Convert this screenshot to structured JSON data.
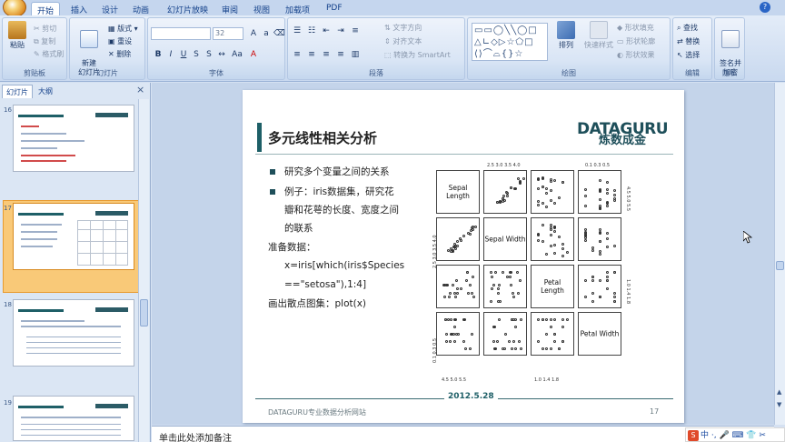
{
  "tabs": [
    "开始",
    "插入",
    "设计",
    "动画",
    "幻灯片放映",
    "审阅",
    "视图",
    "加载项",
    "PDF"
  ],
  "ribbon": {
    "clipboard": {
      "paste": "粘贴",
      "cut": "剪切",
      "copy": "复制",
      "format_painter": "格式刷",
      "label": "剪贴板"
    },
    "slides": {
      "new_slide": "新建\n幻灯片",
      "layout": "版式",
      "reset": "重设",
      "delete": "删除",
      "label": "幻灯片"
    },
    "font": {
      "font_size": "32",
      "label": "字体"
    },
    "paragraph": {
      "text_direction": "文字方向",
      "align_text": "对齐文本",
      "smartart": "转换为 SmartArt",
      "label": "段落"
    },
    "drawing": {
      "arrange": "排列",
      "quick_styles": "快速样式",
      "shape_fill": "形状填充",
      "shape_outline": "形状轮廓",
      "shape_effects": "形状效果",
      "label": "绘图"
    },
    "editing": {
      "find": "查找",
      "replace": "替换",
      "select": "选择",
      "label": "编辑"
    },
    "privacy": {
      "sign": "签名并\n加密",
      "label": "隐私"
    }
  },
  "left_pane": {
    "tabs": [
      "幻灯片",
      "大纲"
    ],
    "close": "×",
    "slide_numbers": [
      "16",
      "17",
      "18",
      "19"
    ],
    "selected_index": 1
  },
  "slide": {
    "title": "多元线性相关分析",
    "logo": "DATAGURU",
    "logo_sub": "炼数成金",
    "bullets": [
      "研究多个变量之间的关系",
      "例子：iris数据集，研究花",
      "瓣和花萼的长度、宽度之间",
      "的联系"
    ],
    "prep_label": "准备数据：",
    "code_lines": [
      "x=iris[which(iris$Species",
      "==\"setosa\"),1:4]"
    ],
    "plot_line": "画出散点图集：plot(x)",
    "footer_date": "2012.5.28",
    "footer_left": "DATAGURU专业数据分析网站",
    "page_number": "17"
  },
  "pairs_plot": {
    "diagonal_labels": [
      "Sepal Length",
      "Sepal Width",
      "Petal Length",
      "Petal Width"
    ],
    "top_ticks_1": "2.5 3.0 3.5 4.0",
    "top_ticks_2": "0.1  0.3  0.5",
    "bottom_ticks_1": "4.5  5.0  5.5",
    "bottom_ticks_2": "1.0  1.4  1.8",
    "right_ticks_1": "4.5  5.0  5.5",
    "right_ticks_2": "1.0  1.4  1.8",
    "left_ticks_1": "2.5 3.0 3.5 4.0",
    "left_ticks_2": "0.1  0.3  0.5"
  },
  "notes": {
    "placeholder": "单击此处添加备注"
  },
  "ime": {
    "text": "中 ·, 🎤 ⌨ 👕 ✂"
  },
  "colors": {
    "accent": "#1e5f67",
    "ribbon": "#c9d9ef",
    "selected_thumb": "#f9c978"
  }
}
